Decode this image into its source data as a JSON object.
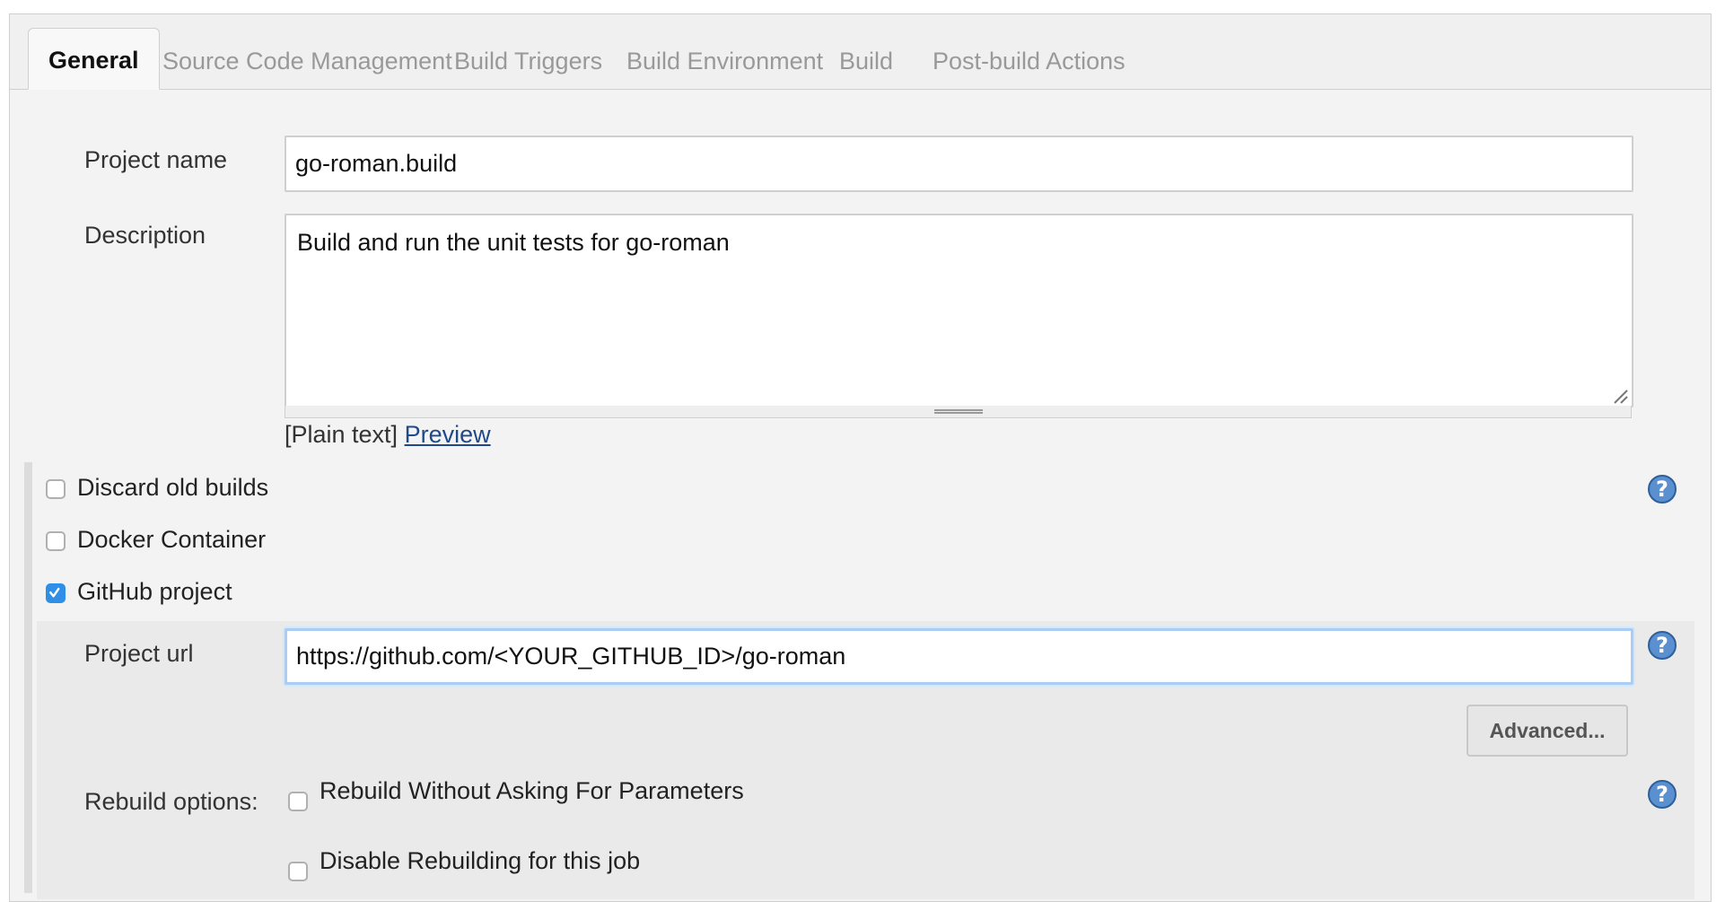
{
  "tabs": [
    {
      "label": "General",
      "active": true
    },
    {
      "label": "Source Code Management",
      "active": false
    },
    {
      "label": "Build Triggers",
      "active": false
    },
    {
      "label": "Build Environment",
      "active": false
    },
    {
      "label": "Build",
      "active": false
    },
    {
      "label": "Post-build Actions",
      "active": false
    }
  ],
  "project_name": {
    "label": "Project name",
    "value": "go-roman.build"
  },
  "description": {
    "label": "Description",
    "value": "Build and run the unit tests for go-roman",
    "format_text": "[Plain text]",
    "preview_link": "Preview"
  },
  "options": {
    "discard_old_builds": {
      "label": "Discard old builds",
      "checked": false
    },
    "docker_container": {
      "label": "Docker Container",
      "checked": false
    },
    "github_project": {
      "label": "GitHub project",
      "checked": true
    }
  },
  "github": {
    "project_url_label": "Project url",
    "project_url_value": "https://github.com/<YOUR_GITHUB_ID>/go-roman",
    "advanced_button": "Advanced..."
  },
  "rebuild": {
    "label": "Rebuild options:",
    "without_asking": {
      "label": "Rebuild Without Asking For Parameters",
      "checked": false
    },
    "disable_rebuilding": {
      "label": "Disable Rebuilding for this job",
      "checked": false
    }
  },
  "help_icon_glyph": "?",
  "colors": {
    "accent": "#2f8ee5",
    "link": "#204a87",
    "help": "#5a8fd0"
  }
}
